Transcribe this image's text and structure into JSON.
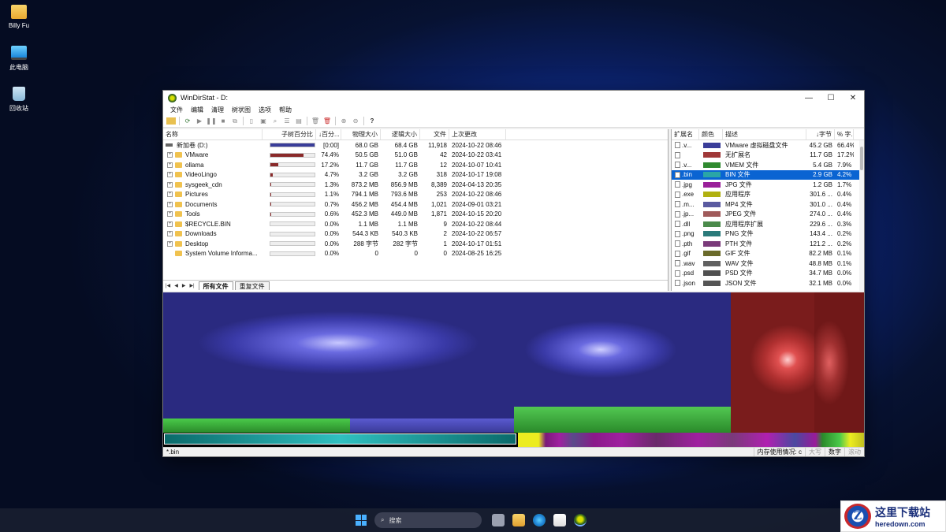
{
  "desktop": {
    "icons": [
      {
        "label": "Billy Fu",
        "icon": "folder-icon"
      },
      {
        "label": "此电脑",
        "icon": "computer-icon"
      },
      {
        "label": "回收站",
        "icon": "recycle-bin-icon"
      }
    ]
  },
  "window": {
    "title": "WinDirStat - D:",
    "controls": {
      "minimize": "—",
      "maximize": "☐",
      "close": "✕"
    }
  },
  "menu": [
    "文件",
    "编辑",
    "清理",
    "树状图",
    "选项",
    "帮助"
  ],
  "toolbar": {
    "help": "?"
  },
  "tree": {
    "headers": {
      "name": "名称",
      "subtree_pct": "子树百分比",
      "pct": "↓百分...",
      "physical": "物理大小",
      "logical": "逻辑大小",
      "files": "文件",
      "modified": "上次更改"
    },
    "root": {
      "name": "新加卷 (D:)",
      "bar": 1.0,
      "pct": "[0:00]",
      "physical": "68.0 GB",
      "logical": "68.4 GB",
      "files": "11,918",
      "modified": "2024-10-22  08:46"
    },
    "rows": [
      {
        "name": "VMware",
        "bar": 0.744,
        "pct": "74.4%",
        "physical": "50.5 GB",
        "logical": "51.0 GB",
        "files": "42",
        "modified": "2024-10-22  03:41"
      },
      {
        "name": "ollama",
        "bar": 0.172,
        "pct": "17.2%",
        "physical": "11.7 GB",
        "logical": "11.7 GB",
        "files": "12",
        "modified": "2024-10-07  10:41"
      },
      {
        "name": "VideoLingo",
        "bar": 0.047,
        "pct": "4.7%",
        "physical": "3.2 GB",
        "logical": "3.2 GB",
        "files": "318",
        "modified": "2024-10-17  19:08"
      },
      {
        "name": "sysgeek_cdn",
        "bar": 0.013,
        "pct": "1.3%",
        "physical": "873.2 MB",
        "logical": "856.9 MB",
        "files": "8,389",
        "modified": "2024-04-13  20:35"
      },
      {
        "name": "Pictures",
        "bar": 0.011,
        "pct": "1.1%",
        "physical": "794.1 MB",
        "logical": "793.6 MB",
        "files": "253",
        "modified": "2024-10-22  08:46"
      },
      {
        "name": "Documents",
        "bar": 0.007,
        "pct": "0.7%",
        "physical": "456.2 MB",
        "logical": "454.4 MB",
        "files": "1,021",
        "modified": "2024-09-01  03:21"
      },
      {
        "name": "Tools",
        "bar": 0.006,
        "pct": "0.6%",
        "physical": "452.3 MB",
        "logical": "449.0 MB",
        "files": "1,871",
        "modified": "2024-10-15  20:20"
      },
      {
        "name": "$RECYCLE.BIN",
        "bar": 0.0,
        "pct": "0.0%",
        "physical": "1.1 MB",
        "logical": "1.1 MB",
        "files": "9",
        "modified": "2024-10-22  08:44"
      },
      {
        "name": "Downloads",
        "bar": 0.0,
        "pct": "0.0%",
        "physical": "544.3 KB",
        "logical": "540.3 KB",
        "files": "2",
        "modified": "2024-10-22  06:57"
      },
      {
        "name": "Desktop",
        "bar": 0.0,
        "pct": "0.0%",
        "physical": "288 字节",
        "logical": "282 字节",
        "files": "1",
        "modified": "2024-10-17  01:51"
      },
      {
        "name": "System Volume Informa...",
        "bar": 0.0,
        "pct": "0.0%",
        "physical": "0",
        "logical": "0",
        "files": "0",
        "modified": "2024-08-25  16:25"
      }
    ],
    "tabs": [
      "所有文件",
      "重复文件"
    ]
  },
  "extensions": {
    "headers": {
      "ext": "扩展名",
      "color": "颜色",
      "desc": "描述",
      "bytes": "↓字节",
      "pct": "% 字..."
    },
    "rows": [
      {
        "ext": ".v...",
        "color": "#3a3d99",
        "desc": "VMware 虚拟磁盘文件",
        "bytes": "45.2 GB",
        "pct": "66.4%"
      },
      {
        "ext": "",
        "color": "#a03838",
        "desc": "无扩展名",
        "bytes": "11.7 GB",
        "pct": "17.2%"
      },
      {
        "ext": ".v...",
        "color": "#2f8a2f",
        "desc": "VMEM 文件",
        "bytes": "5.4 GB",
        "pct": "7.9%"
      },
      {
        "ext": ".bin",
        "color": "#2aa6a6",
        "desc": "BIN 文件",
        "bytes": "2.9 GB",
        "pct": "4.2%",
        "selected": true
      },
      {
        "ext": ".jpg",
        "color": "#9a1f9a",
        "desc": "JPG 文件",
        "bytes": "1.2 GB",
        "pct": "1.7%"
      },
      {
        "ext": ".exe",
        "color": "#b0b010",
        "desc": "应用程序",
        "bytes": "301.6 ...",
        "pct": "0.4%"
      },
      {
        "ext": ".m...",
        "color": "#5a5aa0",
        "desc": "MP4 文件",
        "bytes": "301.0 ...",
        "pct": "0.4%"
      },
      {
        "ext": ".jp...",
        "color": "#a05a5a",
        "desc": "JPEG 文件",
        "bytes": "274.0 ...",
        "pct": "0.4%"
      },
      {
        "ext": ".dll",
        "color": "#4a8a4a",
        "desc": "应用程序扩展",
        "bytes": "229.6 ...",
        "pct": "0.3%"
      },
      {
        "ext": ".png",
        "color": "#2a7a7a",
        "desc": "PNG 文件",
        "bytes": "143.4 ...",
        "pct": "0.2%"
      },
      {
        "ext": ".pth",
        "color": "#7a3a7a",
        "desc": "PTH 文件",
        "bytes": "121.2 ...",
        "pct": "0.2%"
      },
      {
        "ext": ".gif",
        "color": "#6a6a2a",
        "desc": "GIF 文件",
        "bytes": "82.2 MB",
        "pct": "0.1%"
      },
      {
        "ext": ".wav",
        "color": "#606060",
        "desc": "WAV 文件",
        "bytes": "48.8 MB",
        "pct": "0.1%"
      },
      {
        "ext": ".psd",
        "color": "#505050",
        "desc": "PSD 文件",
        "bytes": "34.7 MB",
        "pct": "0.0%"
      },
      {
        "ext": ".json",
        "color": "#555555",
        "desc": "JSON 文件",
        "bytes": "32.1 MB",
        "pct": "0.0%"
      }
    ]
  },
  "status": {
    "path": "*.bin",
    "memory": "内存使用情况: c",
    "caps": "大写",
    "num": "数字",
    "scroll": "滚动"
  },
  "taskbar": {
    "search": "搜索"
  },
  "watermark": {
    "badge": "Z",
    "cn": "这里下载站",
    "en": "heredown.com"
  }
}
